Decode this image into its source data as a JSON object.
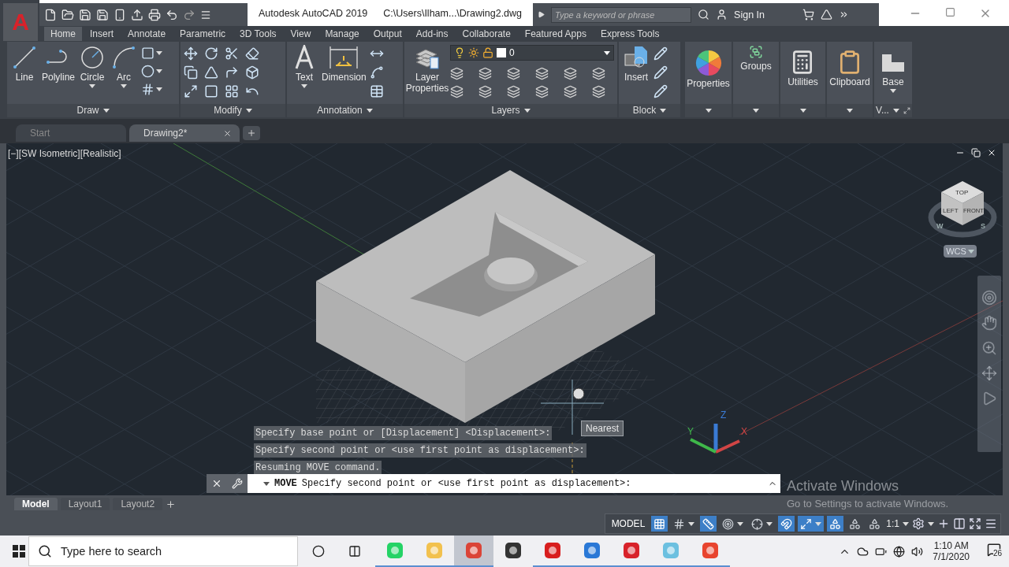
{
  "title_bar": {
    "app_button": "A",
    "title": "Autodesk AutoCAD 2019",
    "file_path": "C:\\Users\\Ilham...\\Drawing2.dwg",
    "search": {
      "placeholder": "Type a keyword or phrase"
    },
    "sign_in": "Sign In"
  },
  "ribbon_tabs": [
    {
      "label": "Home",
      "selected": true
    },
    {
      "label": "Insert",
      "selected": false
    },
    {
      "label": "Annotate",
      "selected": false
    },
    {
      "label": "Parametric",
      "selected": false
    },
    {
      "label": "3D Tools",
      "selected": false
    },
    {
      "label": "View",
      "selected": false
    },
    {
      "label": "Manage",
      "selected": false
    },
    {
      "label": "Output",
      "selected": false
    },
    {
      "label": "Add-ins",
      "selected": false
    },
    {
      "label": "Collaborate",
      "selected": false
    },
    {
      "label": "Featured Apps",
      "selected": false
    },
    {
      "label": "Express Tools",
      "selected": false
    }
  ],
  "ribbon_panels": [
    {
      "kind": "draw",
      "title": "Draw",
      "tools": [
        "Line",
        "Polyline",
        "Circle",
        "Arc"
      ]
    },
    {
      "kind": "modify",
      "title": "Modify"
    },
    {
      "kind": "annotation",
      "title": "Annotation",
      "tools": [
        "Text",
        "Dimension"
      ]
    },
    {
      "kind": "layers",
      "title": "Layers",
      "tools": [
        "Layer Properties"
      ],
      "layer": "0"
    },
    {
      "kind": "block",
      "title": "Block",
      "tools": [
        "Insert"
      ]
    },
    {
      "kind": "properties",
      "tools": [
        "Properties"
      ]
    },
    {
      "kind": "groups",
      "tools": [
        "Groups"
      ]
    },
    {
      "kind": "utilities",
      "tools": [
        "Utilities"
      ]
    },
    {
      "kind": "clipboard",
      "tools": [
        "Clipboard"
      ]
    },
    {
      "kind": "base",
      "title": "V...",
      "tools": [
        "Base"
      ]
    }
  ],
  "file_tabs": [
    {
      "label": "Start",
      "selected": false
    },
    {
      "label": "Drawing2*",
      "selected": true
    }
  ],
  "viewport": {
    "label": "[−][SW Isometric][Realistic]",
    "viewcube": {
      "faces": [
        "TOP",
        "LEFT",
        "FRONT"
      ],
      "compass": [
        "W",
        "S"
      ]
    },
    "ucs_menu": "WCS",
    "tooltip": "Nearest",
    "axes": [
      "X",
      "Y",
      "Z"
    ],
    "history": [
      "Specify base point or [Displacement] <Displacement>:",
      "Specify second point or <use first point as displacement>:",
      "Resuming MOVE command."
    ],
    "command": {
      "name": "MOVE",
      "prompt": "Specify second point or <use first point as displacement>:"
    }
  },
  "activation_notice": {
    "title": "Activate Windows",
    "text": "Go to Settings to activate Windows."
  },
  "layout_tabs": [
    {
      "label": "Model",
      "selected": true
    },
    {
      "label": "Layout1",
      "selected": false
    },
    {
      "label": "Layout2",
      "selected": false
    }
  ],
  "status_bar": {
    "mode": "MODEL",
    "scale": "1:1",
    "toggles": [
      {
        "kind": "grid",
        "on": true,
        "has_menu": false
      },
      {
        "kind": "snap",
        "on": false,
        "has_menu": true
      },
      {
        "kind": "ortho",
        "on": true,
        "has_menu": false
      },
      {
        "kind": "polar",
        "on": false,
        "has_menu": true
      },
      {
        "kind": "isodraft",
        "on": false,
        "has_menu": true
      },
      {
        "kind": "track",
        "on": true,
        "has_menu": false
      },
      {
        "kind": "selection",
        "on": true,
        "has_menu": true
      },
      {
        "kind": "annotation",
        "on": true,
        "has_menu": false
      },
      {
        "kind": "autoscale",
        "on": false,
        "has_menu": false
      },
      {
        "kind": "annoscale",
        "on": false,
        "has_menu": false
      }
    ]
  },
  "taskbar": {
    "search": {
      "placeholder": "Type here to search"
    },
    "apps": [
      {
        "kind": "whatsapp",
        "running": true,
        "selected": false
      },
      {
        "kind": "files",
        "running": true,
        "selected": false
      },
      {
        "kind": "chrome",
        "running": true,
        "selected": true
      },
      {
        "kind": "inkscape",
        "running": false,
        "selected": false
      },
      {
        "kind": "recorder",
        "running": true,
        "selected": false
      },
      {
        "kind": "photos",
        "running": true,
        "selected": false
      },
      {
        "kind": "autocad",
        "running": true,
        "selected": false
      },
      {
        "kind": "notepad",
        "running": true,
        "selected": false
      },
      {
        "kind": "camera",
        "running": true,
        "selected": false
      }
    ],
    "time": "1:10 AM",
    "date": "7/1/2020",
    "notifications": "26"
  }
}
